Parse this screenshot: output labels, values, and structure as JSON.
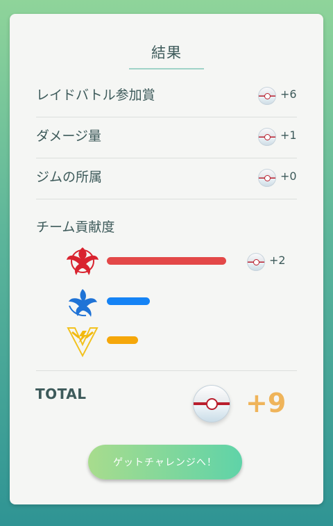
{
  "title": "結果",
  "rewards": [
    {
      "label": "レイドバトル参加賞",
      "value": "+6"
    },
    {
      "label": "ダメージ量",
      "value": "+1"
    },
    {
      "label": "ジムの所属",
      "value": "+0"
    }
  ],
  "team_section": {
    "label": "チーム貢献度",
    "teams": [
      {
        "team": "valor",
        "icon": "valor-emblem-icon",
        "color": "#e34848",
        "contribution_fraction": 1.0,
        "value": "+2"
      },
      {
        "team": "mystic",
        "icon": "mystic-emblem-icon",
        "color": "#1583f5",
        "contribution_fraction": 0.36,
        "value": ""
      },
      {
        "team": "instinct",
        "icon": "instinct-emblem-icon",
        "color": "#f5a70a",
        "contribution_fraction": 0.26,
        "value": ""
      }
    ]
  },
  "total": {
    "label": "TOTAL",
    "value": "+9"
  },
  "cta_label": "ゲットチャレンジへ！"
}
